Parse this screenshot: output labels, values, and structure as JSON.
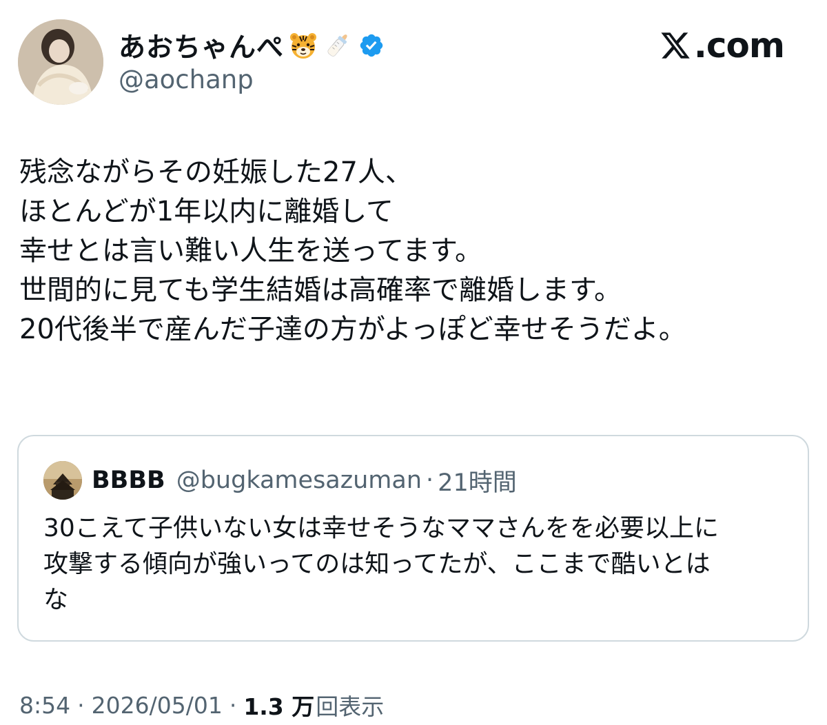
{
  "author": {
    "display_name": "あおちゃんぺ",
    "handle": "@aochanp",
    "name_emojis": [
      "tiger-face-icon",
      "baby-bottle-icon"
    ],
    "verified": true
  },
  "site": {
    "label": ".com",
    "logo": "x-logo-icon"
  },
  "tweet": {
    "lines": [
      "残念ながらその妊娠した27人、",
      "ほとんどが1年以内に離婚して",
      "幸せとは言い難い人生を送ってます。",
      "世間的に見ても学生結婚は高確率で離婚します。",
      "20代後半で産んだ子達の方がよっぽど幸せそうだよ。"
    ]
  },
  "quote": {
    "name": "BBBB",
    "handle": "@bugkamesazuman",
    "separator": "·",
    "time": "21時間",
    "lines": [
      "30こえて子供いない女は幸せそうなママさんをを必要以上に",
      "攻撃する傾向が強いってのは知ってたが、ここまで酷いとは",
      "な"
    ]
  },
  "meta": {
    "time": "8:54",
    "separator": "·",
    "date": "2026/05/01",
    "views_count": "1.3 万",
    "views_label": "回表示"
  },
  "colors": {
    "text_primary": "#0f1419",
    "text_secondary": "#536471",
    "border": "#cfd9de",
    "verified_blue": "#1d9bf0"
  }
}
